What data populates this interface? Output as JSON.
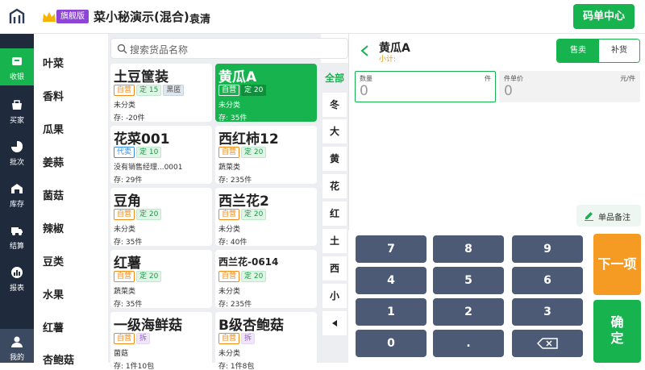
{
  "header": {
    "badge": "旗舰版",
    "store_name": "菜小秘演示(混合)",
    "user_name": "袁清",
    "code_center_label": "码单中心"
  },
  "nav": {
    "items": [
      {
        "label": "收银",
        "icon": "cashier-icon"
      },
      {
        "label": "买家",
        "icon": "buyer-icon"
      },
      {
        "label": "批次",
        "icon": "batch-icon"
      },
      {
        "label": "库存",
        "icon": "inventory-icon"
      },
      {
        "label": "结算",
        "icon": "settlement-icon"
      },
      {
        "label": "报表",
        "icon": "report-icon"
      },
      {
        "label": "我的",
        "icon": "profile-icon"
      }
    ]
  },
  "categories": [
    "叶菜",
    "香料",
    "瓜果",
    "姜蒜",
    "菌菇",
    "辣椒",
    "豆类",
    "水果",
    "红薯",
    "杏鲍菇"
  ],
  "search": {
    "placeholder": "搜索货品名称"
  },
  "products": [
    {
      "name": "土豆筐装",
      "tags": [
        {
          "t": "自营",
          "c": "orange"
        },
        {
          "t": "定 15",
          "c": "green"
        },
        {
          "t": "黑匿",
          "c": "gray"
        }
      ],
      "class": "未分类",
      "stock": "存: -20件"
    },
    {
      "name": "黄瓜A",
      "selected": true,
      "tags": [
        {
          "t": "自营",
          "c": "orange"
        },
        {
          "t": "定 20",
          "c": "green"
        }
      ],
      "class": "未分类",
      "stock": "存: 35件"
    },
    {
      "name": "花菜001",
      "tags": [
        {
          "t": "代卖",
          "c": "blue"
        },
        {
          "t": "定 10",
          "c": "green"
        }
      ],
      "class": "没有销售经理...0001",
      "stock": "存: 29件"
    },
    {
      "name": "西红柿12",
      "tags": [
        {
          "t": "自营",
          "c": "orange"
        },
        {
          "t": "定 20",
          "c": "green"
        }
      ],
      "class": "蔬菜类",
      "stock": "存: 235件"
    },
    {
      "name": "豆角",
      "tags": [
        {
          "t": "自营",
          "c": "orange"
        },
        {
          "t": "定 20",
          "c": "green"
        }
      ],
      "class": "未分类",
      "stock": "存: 35件"
    },
    {
      "name": "西兰花2",
      "tags": [
        {
          "t": "自营",
          "c": "orange"
        },
        {
          "t": "定 20",
          "c": "green"
        }
      ],
      "class": "未分类",
      "stock": "存: 40件"
    },
    {
      "name": "红薯",
      "tags": [
        {
          "t": "自营",
          "c": "orange"
        },
        {
          "t": "定 20",
          "c": "green"
        }
      ],
      "class": "蔬菜类",
      "stock": "存: 35件"
    },
    {
      "name": "西兰花-0614",
      "small": true,
      "tags": [
        {
          "t": "自营",
          "c": "orange"
        },
        {
          "t": "定 20",
          "c": "green"
        }
      ],
      "class": "未分类",
      "stock": "存: 235件"
    },
    {
      "name": "一级海鲜菇",
      "tags": [
        {
          "t": "自营",
          "c": "orange"
        },
        {
          "t": "拆",
          "c": "purple"
        }
      ],
      "class": "菌菇",
      "stock": "存: 1件10包"
    },
    {
      "name": "B级杏鲍菇",
      "tags": [
        {
          "t": "自营",
          "c": "orange"
        },
        {
          "t": "拆",
          "c": "purple"
        }
      ],
      "class": "未分类",
      "stock": "存: 1件8包"
    }
  ],
  "index_letters": [
    "全部",
    "冬",
    "大",
    "黄",
    "花",
    "红",
    "土",
    "西",
    "小"
  ],
  "detail": {
    "title": "黄瓜A",
    "subtotal": "小计:",
    "mode_sell": "售卖",
    "mode_refill": "补货",
    "qty_label": "数量",
    "qty_unit": "件",
    "qty_value": "0",
    "price_label": "件单价",
    "price_unit": "元/件",
    "price_value": "0",
    "note_label": "单品备注"
  },
  "keypad": {
    "rows": [
      [
        "7",
        "8",
        "9"
      ],
      [
        "4",
        "5",
        "6"
      ],
      [
        "1",
        "2",
        "3"
      ],
      [
        "0",
        "."
      ]
    ],
    "next_label": "下一项",
    "confirm_label": "确定"
  },
  "colors": {
    "accent": "#17b34e",
    "nav_bg": "#1f2a3c",
    "key_bg": "#4c5a76",
    "next": "#f59a23",
    "badge": "#8e44d6"
  }
}
